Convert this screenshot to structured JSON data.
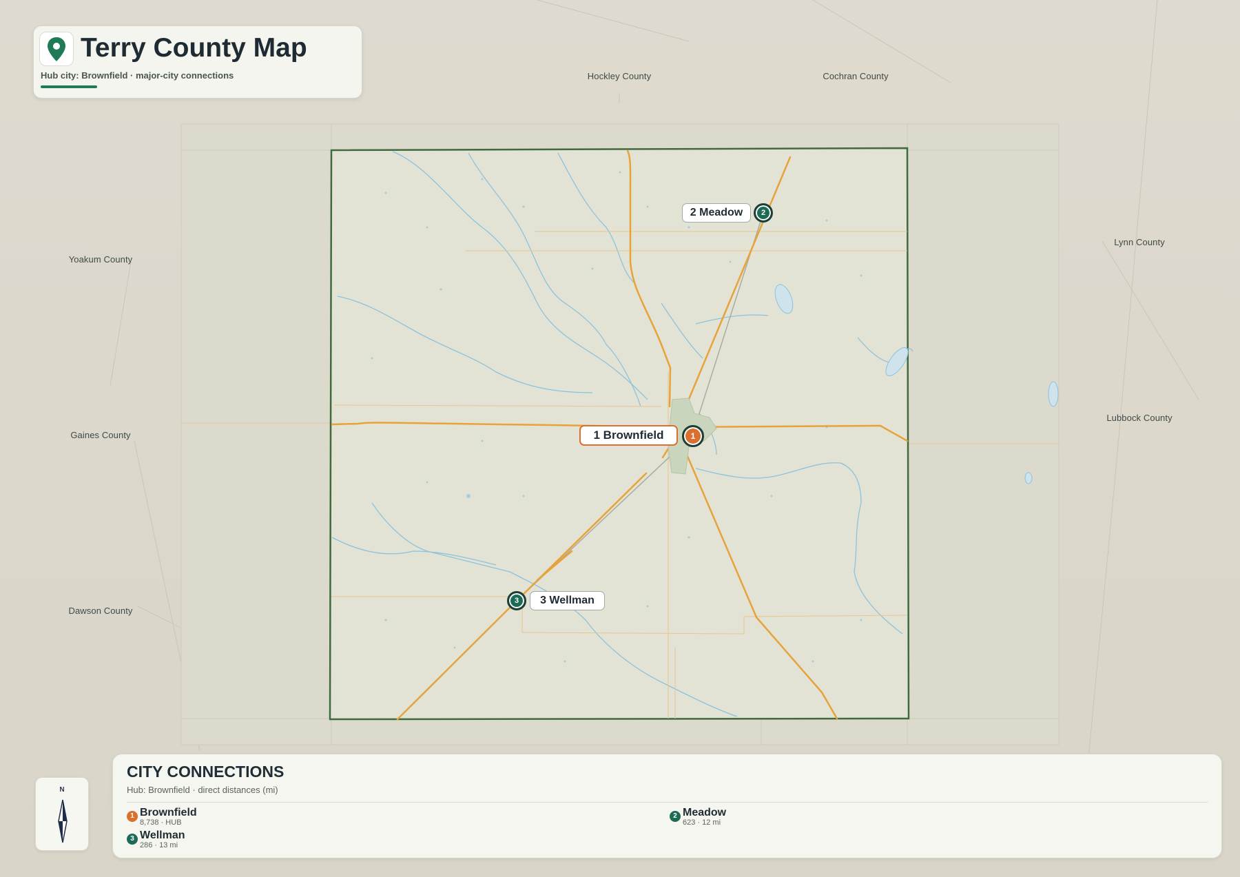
{
  "header": {
    "title": "Terry County Map",
    "subtitle": "Hub city: Brownfield · major-city connections",
    "icon": "map-pin-icon"
  },
  "neighbors": [
    {
      "name": "Hockley County"
    },
    {
      "name": "Cochran County"
    },
    {
      "name": "Yoakum County"
    },
    {
      "name": "Lynn County"
    },
    {
      "name": "Gaines County"
    },
    {
      "name": "Lubbock County"
    },
    {
      "name": "Dawson County"
    }
  ],
  "cities": [
    {
      "id": "brownfield",
      "num": "1",
      "name": "Brownfield",
      "map_label": "1 Brownfield",
      "role": "hub",
      "population": "8,738",
      "meta": "8,738 · HUB",
      "distance_mi": null
    },
    {
      "id": "meadow",
      "num": "2",
      "name": "Meadow",
      "map_label": "2 Meadow",
      "role": "connection",
      "population": "623",
      "meta": "623 · 12 mi",
      "distance_mi": 12
    },
    {
      "id": "wellman",
      "num": "3",
      "name": "Wellman",
      "map_label": "3 Wellman",
      "role": "connection",
      "population": "286",
      "meta": "286 · 13 mi",
      "distance_mi": 13
    }
  ],
  "connections_panel": {
    "title": "CITY CONNECTIONS",
    "subtitle": "Hub: Brownfield · direct distances (mi)"
  },
  "compass": {
    "label": "N",
    "icon": "compass-arrow-icon"
  },
  "colors": {
    "hub": "#d9702f",
    "connection": "#1c6b56",
    "county_border": "#3f6a3c",
    "county_fill": "#e2e3d5",
    "road": "#e8a23a",
    "water": "#8cc2dc",
    "accent": "#1f7a55"
  }
}
